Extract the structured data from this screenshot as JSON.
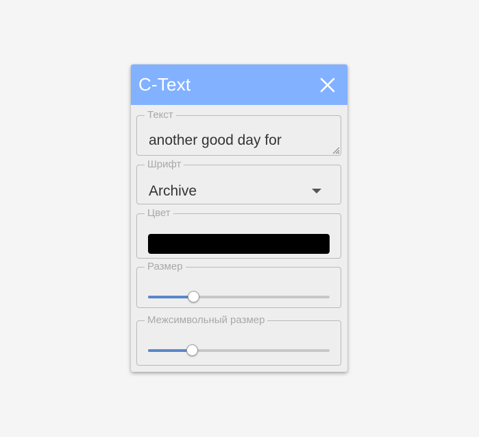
{
  "dialog": {
    "title": "C-Text",
    "close_icon": "close-icon",
    "header_color": "#82b1ff"
  },
  "text_field": {
    "legend": "Текст",
    "value": "another good day for"
  },
  "font_field": {
    "legend": "Шрифт",
    "value": "Archive",
    "dropdown_icon": "caret-down-icon"
  },
  "color_field": {
    "legend": "Цвет",
    "value": "#000000"
  },
  "size_field": {
    "legend": "Размер",
    "value_fraction": 0.25,
    "track_color": "#c8c8c8",
    "fill_color": "#5b86c9"
  },
  "spacing_field": {
    "legend": "Межсимвольный размер",
    "value_fraction": 0.24
  }
}
